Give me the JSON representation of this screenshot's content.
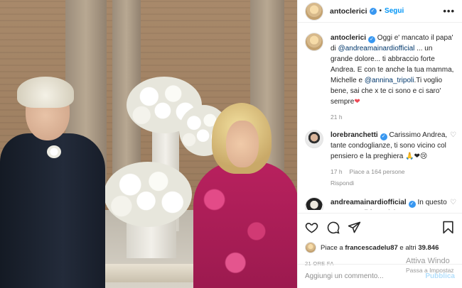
{
  "post": {
    "author": "antoclerici",
    "follow_label": "Segui",
    "separator": "•",
    "more_icon": "•••"
  },
  "caption": {
    "username": "antoclerici",
    "text_1": " Oggi e' mancato il papa' di ",
    "mention_1": "@andreamainardiofficial",
    "text_2": " ... un grande dolore... ti abbraccio forte Andrea. E con te anche la tua mamma, Michelle e ",
    "mention_2": "@annina_tripoli",
    "text_3": ".Ti voglio bene, sai che x te ci sono e ci saro' sempre",
    "emoji": "❤",
    "time": "21 h"
  },
  "comments": [
    {
      "username": "lorebranchetti",
      "text": " Carissimo Andrea, tante condoglianze, ti sono vicino col pensiero e la preghiera 🙏❤😢",
      "time": "17 h",
      "likes": "Piace a 164 persone",
      "reply": "Rispondi"
    },
    {
      "username": "andreamainardiofficial",
      "text": " In questo momento di forte dolore"
    }
  ],
  "likes": {
    "prefix": "Piace a ",
    "user": "francescadelu87",
    "middle": " e altri ",
    "count": "39.846"
  },
  "timestamp": "21 ORE FA",
  "add_comment": {
    "placeholder": "Aggiungi un commento...",
    "publish_label": "Pubblica"
  },
  "watermark": {
    "line1": "Attiva Windo",
    "line2": "Passa a Impostaz"
  },
  "colors": {
    "link": "#0095f6",
    "verified": "#3897f0",
    "heart": "#ed4956"
  }
}
